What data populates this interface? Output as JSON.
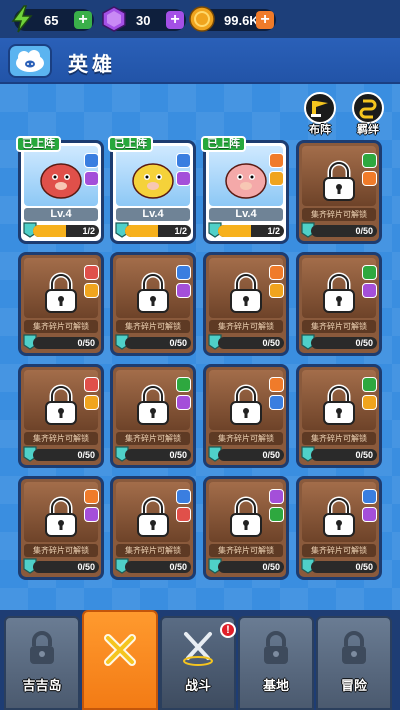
{
  "resources": {
    "energy": {
      "value": "65",
      "icon": "lightning-icon",
      "color": "#6fd23a"
    },
    "gems": {
      "value": "30",
      "icon": "gem-icon",
      "color": "#a450e6"
    },
    "coins": {
      "value": "99.6K",
      "icon": "coin-icon",
      "color": "#f0a41e"
    },
    "plus": "+"
  },
  "header": {
    "title": "英雄",
    "icon": "cloud-pig-icon"
  },
  "side_buttons": [
    {
      "label": "布阵",
      "icon": "formation-icon"
    },
    {
      "label": "羁绊",
      "icon": "bond-icon"
    }
  ],
  "deployed_label": "已上阵",
  "unlock_hint": "集齐碎片可解锁",
  "heroes": [
    {
      "status": "deployed",
      "level": "Lv.4",
      "progress": "1/2",
      "fraction": 0.5,
      "badge_top": "#3a7ee0",
      "badge_bottom": "#a44fd9",
      "color": "#e0504a"
    },
    {
      "status": "deployed",
      "level": "Lv.4",
      "progress": "1/2",
      "fraction": 0.5,
      "badge_top": "#3a7ee0",
      "badge_bottom": "#a44fd9",
      "color": "#f5d23a"
    },
    {
      "status": "deployed",
      "level": "Lv.4",
      "progress": "1/2",
      "fraction": 0.5,
      "badge_top": "#f07b2a",
      "badge_bottom": "#f0a41e",
      "color": "#f4a9a9"
    },
    {
      "status": "locked",
      "progress": "0/50",
      "fraction": 0,
      "badge_top": "#2ea83f",
      "badge_bottom": "#f07b2a"
    },
    {
      "status": "locked",
      "progress": "0/50",
      "fraction": 0,
      "badge_top": "#e0504a",
      "badge_bottom": "#f0a41e"
    },
    {
      "status": "locked",
      "progress": "0/50",
      "fraction": 0,
      "badge_top": "#3a7ee0",
      "badge_bottom": "#a44fd9"
    },
    {
      "status": "locked",
      "progress": "0/50",
      "fraction": 0,
      "badge_top": "#f07b2a",
      "badge_bottom": "#f0a41e"
    },
    {
      "status": "locked",
      "progress": "0/50",
      "fraction": 0,
      "badge_top": "#2ea83f",
      "badge_bottom": "#a44fd9"
    },
    {
      "status": "locked",
      "progress": "0/50",
      "fraction": 0,
      "badge_top": "#e0504a",
      "badge_bottom": "#f0a41e"
    },
    {
      "status": "locked",
      "progress": "0/50",
      "fraction": 0,
      "badge_top": "#2ea83f",
      "badge_bottom": "#a44fd9"
    },
    {
      "status": "locked",
      "progress": "0/50",
      "fraction": 0,
      "badge_top": "#f07b2a",
      "badge_bottom": "#3a7ee0"
    },
    {
      "status": "locked",
      "progress": "0/50",
      "fraction": 0,
      "badge_top": "#2ea83f",
      "badge_bottom": "#f0a41e"
    },
    {
      "status": "locked",
      "progress": "0/50",
      "fraction": 0,
      "badge_top": "#f07b2a",
      "badge_bottom": "#a44fd9"
    },
    {
      "status": "locked",
      "progress": "0/50",
      "fraction": 0,
      "badge_top": "#3a7ee0",
      "badge_bottom": "#e0504a"
    },
    {
      "status": "locked",
      "progress": "0/50",
      "fraction": 0,
      "badge_top": "#a44fd9",
      "badge_bottom": "#2ea83f"
    },
    {
      "status": "locked",
      "progress": "0/50",
      "fraction": 0,
      "badge_top": "#3a7ee0",
      "badge_bottom": "#a44fd9"
    }
  ],
  "nav": [
    {
      "label": "吉吉岛",
      "icon": "lock-icon",
      "active": false
    },
    {
      "label": "",
      "icon": "hero-cross-icon",
      "active": true
    },
    {
      "label": "战斗",
      "icon": "crossed-swords-icon",
      "active": false,
      "notification": "!"
    },
    {
      "label": "基地",
      "icon": "lock-icon",
      "active": false
    },
    {
      "label": "冒险",
      "icon": "lock-icon",
      "active": false
    }
  ]
}
